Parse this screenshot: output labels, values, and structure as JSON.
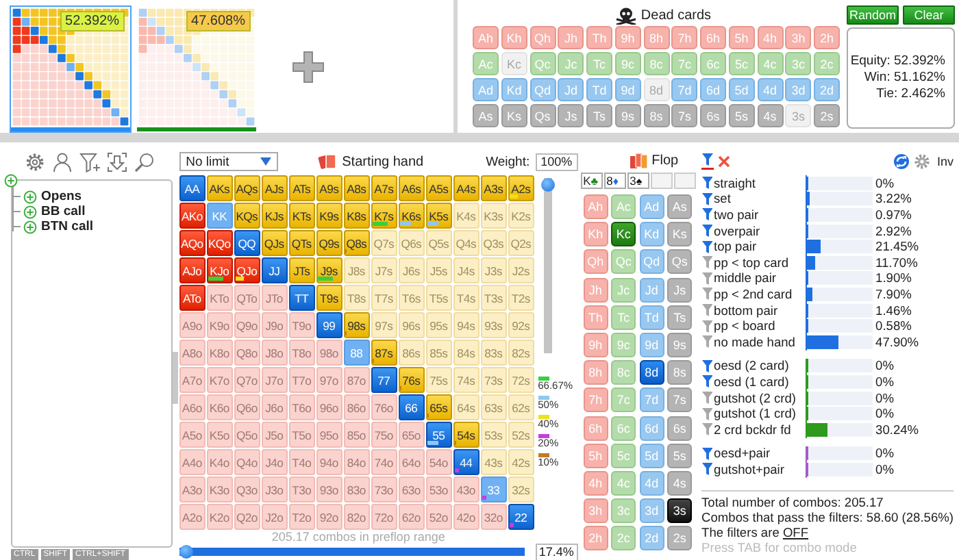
{
  "ranges": [
    {
      "selected": true,
      "badge": {
        "text": "52.392%",
        "color": "#d9f244"
      },
      "bar": {
        "color": "#2a8cf0"
      }
    },
    {
      "selected": false,
      "badge": {
        "text": "47.608%",
        "color": "#f6c94a"
      },
      "bar": {
        "color": "#16921a"
      }
    }
  ],
  "dead_cards": {
    "title": "Dead cards",
    "suits": [
      {
        "kind": "hearts",
        "cards": [
          {
            "label": "Ah",
            "disabled": false
          },
          {
            "label": "Kh",
            "disabled": false
          },
          {
            "label": "Qh",
            "disabled": false
          },
          {
            "label": "Jh",
            "disabled": false
          },
          {
            "label": "Th",
            "disabled": false
          },
          {
            "label": "9h",
            "disabled": false
          },
          {
            "label": "8h",
            "disabled": false
          },
          {
            "label": "7h",
            "disabled": false
          },
          {
            "label": "6h",
            "disabled": false
          },
          {
            "label": "5h",
            "disabled": false
          },
          {
            "label": "4h",
            "disabled": false
          },
          {
            "label": "3h",
            "disabled": false
          },
          {
            "label": "2h",
            "disabled": false
          }
        ]
      },
      {
        "kind": "clubs",
        "cards": [
          {
            "label": "Ac",
            "disabled": false
          },
          {
            "label": "Kc",
            "disabled": true
          },
          {
            "label": "Qc",
            "disabled": false
          },
          {
            "label": "Jc",
            "disabled": false
          },
          {
            "label": "Tc",
            "disabled": false
          },
          {
            "label": "9c",
            "disabled": false
          },
          {
            "label": "8c",
            "disabled": false
          },
          {
            "label": "7c",
            "disabled": false
          },
          {
            "label": "6c",
            "disabled": false
          },
          {
            "label": "5c",
            "disabled": false
          },
          {
            "label": "4c",
            "disabled": false
          },
          {
            "label": "3c",
            "disabled": false
          },
          {
            "label": "2c",
            "disabled": false
          }
        ]
      },
      {
        "kind": "diamonds",
        "cards": [
          {
            "label": "Ad",
            "disabled": false
          },
          {
            "label": "Kd",
            "disabled": false
          },
          {
            "label": "Qd",
            "disabled": false
          },
          {
            "label": "Jd",
            "disabled": false
          },
          {
            "label": "Td",
            "disabled": false
          },
          {
            "label": "9d",
            "disabled": false
          },
          {
            "label": "8d",
            "disabled": true
          },
          {
            "label": "7d",
            "disabled": false
          },
          {
            "label": "6d",
            "disabled": false
          },
          {
            "label": "5d",
            "disabled": false
          },
          {
            "label": "4d",
            "disabled": false
          },
          {
            "label": "3d",
            "disabled": false
          },
          {
            "label": "2d",
            "disabled": false
          }
        ]
      },
      {
        "kind": "spades",
        "cards": [
          {
            "label": "As",
            "disabled": false
          },
          {
            "label": "Ks",
            "disabled": false
          },
          {
            "label": "Qs",
            "disabled": false
          },
          {
            "label": "Js",
            "disabled": false
          },
          {
            "label": "Ts",
            "disabled": false
          },
          {
            "label": "9s",
            "disabled": false
          },
          {
            "label": "8s",
            "disabled": false
          },
          {
            "label": "7s",
            "disabled": false
          },
          {
            "label": "6s",
            "disabled": false
          },
          {
            "label": "5s",
            "disabled": false
          },
          {
            "label": "4s",
            "disabled": false
          },
          {
            "label": "3s",
            "disabled": true
          },
          {
            "label": "2s",
            "disabled": false
          }
        ]
      }
    ]
  },
  "buttons": [
    "Random",
    "Clear"
  ],
  "equity_lines": [
    "Equity: 52.392%",
    "Win: 51.162%",
    "Tie: 2.462%"
  ],
  "tree": {
    "children": [
      {
        "label": "Opens",
        "expanded": false
      },
      {
        "label": "BB call",
        "expanded": false
      },
      {
        "label": "BTN call",
        "expanded": false
      }
    ]
  },
  "modifier_keys": [
    "CTRL",
    "SHIFT",
    "CTRL+SHIFT"
  ],
  "hand_grid": {
    "game": "No limit",
    "title": "Starting hand",
    "weight_label": "Weight:",
    "weight": "100%",
    "weight_slider": {
      "level": 1
    },
    "rows": [
      {
        "cells": [
          {
            "label": "AA",
            "kind": "pair",
            "selected": true
          },
          {
            "label": "AKs",
            "kind": "suited",
            "selected": true
          },
          {
            "label": "AQs",
            "kind": "suited",
            "selected": true
          },
          {
            "label": "AJs",
            "kind": "suited",
            "selected": true
          },
          {
            "label": "ATs",
            "kind": "suited",
            "selected": true
          },
          {
            "label": "A9s",
            "kind": "suited",
            "selected": true
          },
          {
            "label": "A8s",
            "kind": "suited",
            "selected": true
          },
          {
            "label": "A7s",
            "kind": "suited",
            "selected": true
          },
          {
            "label": "A6s",
            "kind": "suited",
            "selected": true
          },
          {
            "label": "A5s",
            "kind": "suited",
            "selected": true
          },
          {
            "label": "A4s",
            "kind": "suited",
            "selected": true
          },
          {
            "label": "A3s",
            "kind": "suited",
            "selected": true
          },
          {
            "label": "A2s",
            "kind": "suited",
            "selected": true,
            "marker": {
              "color": "#ece21a",
              "level": 0.4
            }
          }
        ]
      },
      {
        "cells": [
          {
            "label": "AKo",
            "kind": "offsuit",
            "selected": true
          },
          {
            "label": "KK",
            "kind": "pair",
            "selected": true,
            "faded": true
          },
          {
            "label": "KQs",
            "kind": "suited",
            "selected": true
          },
          {
            "label": "KJs",
            "kind": "suited",
            "selected": true
          },
          {
            "label": "KTs",
            "kind": "suited",
            "selected": true
          },
          {
            "label": "K9s",
            "kind": "suited",
            "selected": true
          },
          {
            "label": "K8s",
            "kind": "suited",
            "selected": true
          },
          {
            "label": "K7s",
            "kind": "suited",
            "selected": true,
            "marker": {
              "color": "#3ccf3c",
              "level": 0.6667
            }
          },
          {
            "label": "K6s",
            "kind": "suited",
            "selected": true,
            "marker": {
              "color": "#8ec8f2",
              "level": 0.5
            }
          },
          {
            "label": "K5s",
            "kind": "suited",
            "selected": true,
            "marker": {
              "color": "#8ec8f2",
              "level": 0.5
            }
          },
          {
            "label": "K4s",
            "kind": "suited",
            "selected": false
          },
          {
            "label": "K3s",
            "kind": "suited",
            "selected": false
          },
          {
            "label": "K2s",
            "kind": "suited",
            "selected": false
          }
        ]
      },
      {
        "cells": [
          {
            "label": "AQo",
            "kind": "offsuit",
            "selected": true
          },
          {
            "label": "KQo",
            "kind": "offsuit",
            "selected": true
          },
          {
            "label": "QQ",
            "kind": "pair",
            "selected": true
          },
          {
            "label": "QJs",
            "kind": "suited",
            "selected": true
          },
          {
            "label": "QTs",
            "kind": "suited",
            "selected": true
          },
          {
            "label": "Q9s",
            "kind": "suited",
            "selected": true
          },
          {
            "label": "Q8s",
            "kind": "suited",
            "selected": true,
            "marker": {
              "color": "#c47a24",
              "level": 0.1
            }
          },
          {
            "label": "Q7s",
            "kind": "suited",
            "selected": false
          },
          {
            "label": "Q6s",
            "kind": "suited",
            "selected": false
          },
          {
            "label": "Q5s",
            "kind": "suited",
            "selected": false
          },
          {
            "label": "Q4s",
            "kind": "suited",
            "selected": false
          },
          {
            "label": "Q3s",
            "kind": "suited",
            "selected": false
          },
          {
            "label": "Q2s",
            "kind": "suited",
            "selected": false
          }
        ]
      },
      {
        "cells": [
          {
            "label": "AJo",
            "kind": "offsuit",
            "selected": true
          },
          {
            "label": "KJo",
            "kind": "offsuit",
            "selected": true,
            "marker": {
              "color": "#3ccf3c",
              "level": 0.6667
            }
          },
          {
            "label": "QJo",
            "kind": "offsuit",
            "selected": true,
            "marker": {
              "color": "#ece21a",
              "level": 0.4
            }
          },
          {
            "label": "JJ",
            "kind": "pair",
            "selected": true
          },
          {
            "label": "JTs",
            "kind": "suited",
            "selected": true
          },
          {
            "label": "J9s",
            "kind": "suited",
            "selected": true,
            "marker": {
              "color": "#3ccf3c",
              "level": 0.6667
            }
          },
          {
            "label": "J8s",
            "kind": "suited",
            "selected": false
          },
          {
            "label": "J7s",
            "kind": "suited",
            "selected": false
          },
          {
            "label": "J6s",
            "kind": "suited",
            "selected": false
          },
          {
            "label": "J5s",
            "kind": "suited",
            "selected": false
          },
          {
            "label": "J4s",
            "kind": "suited",
            "selected": false
          },
          {
            "label": "J3s",
            "kind": "suited",
            "selected": false
          },
          {
            "label": "J2s",
            "kind": "suited",
            "selected": false
          }
        ]
      },
      {
        "cells": [
          {
            "label": "ATo",
            "kind": "offsuit",
            "selected": true
          },
          {
            "label": "KTo",
            "kind": "offsuit",
            "selected": false
          },
          {
            "label": "QTo",
            "kind": "offsuit",
            "selected": false
          },
          {
            "label": "JTo",
            "kind": "offsuit",
            "selected": false
          },
          {
            "label": "TT",
            "kind": "pair",
            "selected": true
          },
          {
            "label": "T9s",
            "kind": "suited",
            "selected": true
          },
          {
            "label": "T8s",
            "kind": "suited",
            "selected": false
          },
          {
            "label": "T7s",
            "kind": "suited",
            "selected": false
          },
          {
            "label": "T6s",
            "kind": "suited",
            "selected": false
          },
          {
            "label": "T5s",
            "kind": "suited",
            "selected": false
          },
          {
            "label": "T4s",
            "kind": "suited",
            "selected": false
          },
          {
            "label": "T3s",
            "kind": "suited",
            "selected": false
          },
          {
            "label": "T2s",
            "kind": "suited",
            "selected": false
          }
        ]
      },
      {
        "cells": [
          {
            "label": "A9o",
            "kind": "offsuit",
            "selected": false
          },
          {
            "label": "K9o",
            "kind": "offsuit",
            "selected": false
          },
          {
            "label": "Q9o",
            "kind": "offsuit",
            "selected": false
          },
          {
            "label": "J9o",
            "kind": "offsuit",
            "selected": false
          },
          {
            "label": "T9o",
            "kind": "offsuit",
            "selected": false
          },
          {
            "label": "99",
            "kind": "pair",
            "selected": true
          },
          {
            "label": "98s",
            "kind": "suited",
            "selected": true,
            "marker": {
              "color": "#c47a24",
              "level": 0.1
            }
          },
          {
            "label": "97s",
            "kind": "suited",
            "selected": false
          },
          {
            "label": "96s",
            "kind": "suited",
            "selected": false
          },
          {
            "label": "95s",
            "kind": "suited",
            "selected": false
          },
          {
            "label": "94s",
            "kind": "suited",
            "selected": false
          },
          {
            "label": "93s",
            "kind": "suited",
            "selected": false
          },
          {
            "label": "92s",
            "kind": "suited",
            "selected": false
          }
        ]
      },
      {
        "cells": [
          {
            "label": "A8o",
            "kind": "offsuit",
            "selected": false
          },
          {
            "label": "K8o",
            "kind": "offsuit",
            "selected": false
          },
          {
            "label": "Q8o",
            "kind": "offsuit",
            "selected": false
          },
          {
            "label": "J8o",
            "kind": "offsuit",
            "selected": false
          },
          {
            "label": "T8o",
            "kind": "offsuit",
            "selected": false
          },
          {
            "label": "98o",
            "kind": "offsuit",
            "selected": false
          },
          {
            "label": "88",
            "kind": "pair",
            "selected": true,
            "faded": true
          },
          {
            "label": "87s",
            "kind": "suited",
            "selected": true,
            "marker": {
              "color": "#c47a24",
              "level": 0.1
            }
          },
          {
            "label": "86s",
            "kind": "suited",
            "selected": false
          },
          {
            "label": "85s",
            "kind": "suited",
            "selected": false
          },
          {
            "label": "84s",
            "kind": "suited",
            "selected": false
          },
          {
            "label": "83s",
            "kind": "suited",
            "selected": false
          },
          {
            "label": "82s",
            "kind": "suited",
            "selected": false
          }
        ]
      },
      {
        "cells": [
          {
            "label": "A7o",
            "kind": "offsuit",
            "selected": false
          },
          {
            "label": "K7o",
            "kind": "offsuit",
            "selected": false
          },
          {
            "label": "Q7o",
            "kind": "offsuit",
            "selected": false
          },
          {
            "label": "J7o",
            "kind": "offsuit",
            "selected": false
          },
          {
            "label": "T7o",
            "kind": "offsuit",
            "selected": false
          },
          {
            "label": "97o",
            "kind": "offsuit",
            "selected": false
          },
          {
            "label": "87o",
            "kind": "offsuit",
            "selected": false
          },
          {
            "label": "77",
            "kind": "pair",
            "selected": true
          },
          {
            "label": "76s",
            "kind": "suited",
            "selected": true,
            "marker": {
              "color": "#c47a24",
              "level": 0.1
            }
          },
          {
            "label": "75s",
            "kind": "suited",
            "selected": false
          },
          {
            "label": "74s",
            "kind": "suited",
            "selected": false
          },
          {
            "label": "73s",
            "kind": "suited",
            "selected": false
          },
          {
            "label": "72s",
            "kind": "suited",
            "selected": false
          }
        ]
      },
      {
        "cells": [
          {
            "label": "A6o",
            "kind": "offsuit",
            "selected": false
          },
          {
            "label": "K6o",
            "kind": "offsuit",
            "selected": false
          },
          {
            "label": "Q6o",
            "kind": "offsuit",
            "selected": false
          },
          {
            "label": "J6o",
            "kind": "offsuit",
            "selected": false
          },
          {
            "label": "T6o",
            "kind": "offsuit",
            "selected": false
          },
          {
            "label": "96o",
            "kind": "offsuit",
            "selected": false
          },
          {
            "label": "86o",
            "kind": "offsuit",
            "selected": false
          },
          {
            "label": "76o",
            "kind": "offsuit",
            "selected": false
          },
          {
            "label": "66",
            "kind": "pair",
            "selected": true
          },
          {
            "label": "65s",
            "kind": "suited",
            "selected": true,
            "marker": {
              "color": "#c47a24",
              "level": 0.1
            }
          },
          {
            "label": "64s",
            "kind": "suited",
            "selected": false
          },
          {
            "label": "63s",
            "kind": "suited",
            "selected": false
          },
          {
            "label": "62s",
            "kind": "suited",
            "selected": false
          }
        ]
      },
      {
        "cells": [
          {
            "label": "A5o",
            "kind": "offsuit",
            "selected": false
          },
          {
            "label": "K5o",
            "kind": "offsuit",
            "selected": false
          },
          {
            "label": "Q5o",
            "kind": "offsuit",
            "selected": false
          },
          {
            "label": "J5o",
            "kind": "offsuit",
            "selected": false
          },
          {
            "label": "T5o",
            "kind": "offsuit",
            "selected": false
          },
          {
            "label": "95o",
            "kind": "offsuit",
            "selected": false
          },
          {
            "label": "85o",
            "kind": "offsuit",
            "selected": false
          },
          {
            "label": "75o",
            "kind": "offsuit",
            "selected": false
          },
          {
            "label": "65o",
            "kind": "offsuit",
            "selected": false
          },
          {
            "label": "55",
            "kind": "pair",
            "selected": true,
            "marker": {
              "color": "#8ec8f2",
              "level": 0.5
            }
          },
          {
            "label": "54s",
            "kind": "suited",
            "selected": true,
            "marker": {
              "color": "#c47a24",
              "level": 0.1
            }
          },
          {
            "label": "53s",
            "kind": "suited",
            "selected": false
          },
          {
            "label": "52s",
            "kind": "suited",
            "selected": false
          }
        ]
      },
      {
        "cells": [
          {
            "label": "A4o",
            "kind": "offsuit",
            "selected": false
          },
          {
            "label": "K4o",
            "kind": "offsuit",
            "selected": false
          },
          {
            "label": "Q4o",
            "kind": "offsuit",
            "selected": false
          },
          {
            "label": "J4o",
            "kind": "offsuit",
            "selected": false
          },
          {
            "label": "T4o",
            "kind": "offsuit",
            "selected": false
          },
          {
            "label": "94o",
            "kind": "offsuit",
            "selected": false
          },
          {
            "label": "84o",
            "kind": "offsuit",
            "selected": false
          },
          {
            "label": "74o",
            "kind": "offsuit",
            "selected": false
          },
          {
            "label": "64o",
            "kind": "offsuit",
            "selected": false
          },
          {
            "label": "54o",
            "kind": "offsuit",
            "selected": false
          },
          {
            "label": "44",
            "kind": "pair",
            "selected": true,
            "marker": {
              "color": "#c43ee0",
              "level": 0.2
            }
          },
          {
            "label": "43s",
            "kind": "suited",
            "selected": false
          },
          {
            "label": "42s",
            "kind": "suited",
            "selected": false
          }
        ]
      },
      {
        "cells": [
          {
            "label": "A3o",
            "kind": "offsuit",
            "selected": false
          },
          {
            "label": "K3o",
            "kind": "offsuit",
            "selected": false
          },
          {
            "label": "Q3o",
            "kind": "offsuit",
            "selected": false
          },
          {
            "label": "J3o",
            "kind": "offsuit",
            "selected": false
          },
          {
            "label": "T3o",
            "kind": "offsuit",
            "selected": false
          },
          {
            "label": "93o",
            "kind": "offsuit",
            "selected": false
          },
          {
            "label": "83o",
            "kind": "offsuit",
            "selected": false
          },
          {
            "label": "73o",
            "kind": "offsuit",
            "selected": false
          },
          {
            "label": "63o",
            "kind": "offsuit",
            "selected": false
          },
          {
            "label": "53o",
            "kind": "offsuit",
            "selected": false
          },
          {
            "label": "43o",
            "kind": "offsuit",
            "selected": false
          },
          {
            "label": "33",
            "kind": "pair",
            "selected": true,
            "faded": true,
            "marker": {
              "color": "#c43ee0",
              "level": 0.2
            }
          },
          {
            "label": "32s",
            "kind": "suited",
            "selected": false
          }
        ]
      },
      {
        "cells": [
          {
            "label": "A2o",
            "kind": "offsuit",
            "selected": false
          },
          {
            "label": "K2o",
            "kind": "offsuit",
            "selected": false
          },
          {
            "label": "Q2o",
            "kind": "offsuit",
            "selected": false
          },
          {
            "label": "J2o",
            "kind": "offsuit",
            "selected": false
          },
          {
            "label": "T2o",
            "kind": "offsuit",
            "selected": false
          },
          {
            "label": "92o",
            "kind": "offsuit",
            "selected": false
          },
          {
            "label": "82o",
            "kind": "offsuit",
            "selected": false
          },
          {
            "label": "72o",
            "kind": "offsuit",
            "selected": false
          },
          {
            "label": "62o",
            "kind": "offsuit",
            "selected": false
          },
          {
            "label": "52o",
            "kind": "offsuit",
            "selected": false
          },
          {
            "label": "42o",
            "kind": "offsuit",
            "selected": false
          },
          {
            "label": "32o",
            "kind": "offsuit",
            "selected": false
          },
          {
            "label": "22",
            "kind": "pair",
            "selected": true,
            "marker": {
              "color": "#c43ee0",
              "level": 0.2
            }
          }
        ]
      }
    ],
    "legend": [
      {
        "label": "66.67%",
        "color": "#3ccf3c"
      },
      {
        "label": "50%",
        "color": "#8ec8f2"
      },
      {
        "label": "40%",
        "color": "#ece21a"
      },
      {
        "label": "20%",
        "color": "#c43ee0"
      },
      {
        "label": "10%",
        "color": "#c47a24"
      }
    ],
    "combos_text": "205.17 combos in preflop range",
    "range_slider": {
      "level": 0
    },
    "range_percent": "17.4%"
  },
  "flop": {
    "title": "Flop",
    "board": [
      {
        "kind": "clubs",
        "rank": "K",
        "symbol": "♣"
      },
      {
        "kind": "diamonds",
        "rank": "8",
        "symbol": "♦"
      },
      {
        "kind": "spades",
        "rank": "3",
        "symbol": "♠"
      },
      {
        "kind": "empty"
      },
      {
        "kind": "empty"
      }
    ],
    "deck": [
      {
        "kind": "hearts",
        "cards": [
          {
            "label": "Ah",
            "selected": false
          },
          {
            "label": "Kh",
            "selected": false
          },
          {
            "label": "Qh",
            "selected": false
          },
          {
            "label": "Jh",
            "selected": false
          },
          {
            "label": "Th",
            "selected": false
          },
          {
            "label": "9h",
            "selected": false
          },
          {
            "label": "8h",
            "selected": false
          },
          {
            "label": "7h",
            "selected": false
          },
          {
            "label": "6h",
            "selected": false
          },
          {
            "label": "5h",
            "selected": false
          },
          {
            "label": "4h",
            "selected": false
          },
          {
            "label": "3h",
            "selected": false
          },
          {
            "label": "2h",
            "selected": false
          }
        ]
      },
      {
        "kind": "clubs",
        "cards": [
          {
            "label": "Ac",
            "selected": false
          },
          {
            "label": "Kc",
            "selected": true
          },
          {
            "label": "Qc",
            "selected": false
          },
          {
            "label": "Jc",
            "selected": false
          },
          {
            "label": "Tc",
            "selected": false
          },
          {
            "label": "9c",
            "selected": false
          },
          {
            "label": "8c",
            "selected": false
          },
          {
            "label": "7c",
            "selected": false
          },
          {
            "label": "6c",
            "selected": false
          },
          {
            "label": "5c",
            "selected": false
          },
          {
            "label": "4c",
            "selected": false
          },
          {
            "label": "3c",
            "selected": false
          },
          {
            "label": "2c",
            "selected": false
          }
        ]
      },
      {
        "kind": "diamonds",
        "cards": [
          {
            "label": "Ad",
            "selected": false
          },
          {
            "label": "Kd",
            "selected": false
          },
          {
            "label": "Qd",
            "selected": false
          },
          {
            "label": "Jd",
            "selected": false
          },
          {
            "label": "Td",
            "selected": false
          },
          {
            "label": "9d",
            "selected": false
          },
          {
            "label": "8d",
            "selected": true
          },
          {
            "label": "7d",
            "selected": false
          },
          {
            "label": "6d",
            "selected": false
          },
          {
            "label": "5d",
            "selected": false
          },
          {
            "label": "4d",
            "selected": false
          },
          {
            "label": "3d",
            "selected": false
          },
          {
            "label": "2d",
            "selected": false
          }
        ]
      },
      {
        "kind": "spades",
        "cards": [
          {
            "label": "As",
            "selected": false
          },
          {
            "label": "Ks",
            "selected": false
          },
          {
            "label": "Qs",
            "selected": false
          },
          {
            "label": "Js",
            "selected": false
          },
          {
            "label": "Ts",
            "selected": false
          },
          {
            "label": "9s",
            "selected": false
          },
          {
            "label": "8s",
            "selected": false
          },
          {
            "label": "7s",
            "selected": false
          },
          {
            "label": "6s",
            "selected": false
          },
          {
            "label": "5s",
            "selected": false
          },
          {
            "label": "4s",
            "selected": false
          },
          {
            "label": "3s",
            "selected": true
          },
          {
            "label": "2s",
            "selected": false
          }
        ]
      }
    ]
  },
  "filters": {
    "inverse_label": "Inv",
    "groups": [
      {
        "color": "#1f6fe0",
        "rows": [
          {
            "label": "straight",
            "active": true,
            "level": 0,
            "value": "0%"
          },
          {
            "label": "set",
            "active": true,
            "level": 0.0322,
            "value": "3.22%"
          },
          {
            "label": "two pair",
            "active": true,
            "level": 0.0097,
            "value": "0.97%"
          },
          {
            "label": "overpair",
            "active": true,
            "level": 0.0292,
            "value": "2.92%"
          },
          {
            "label": "top pair",
            "active": true,
            "level": 0.2145,
            "value": "21.45%"
          },
          {
            "label": "pp < top card",
            "active": false,
            "level": 0.117,
            "value": "11.70%"
          },
          {
            "label": "middle pair",
            "active": false,
            "level": 0.019,
            "value": "1.90%"
          },
          {
            "label": "pp < 2nd card",
            "active": false,
            "level": 0.079,
            "value": "7.90%"
          },
          {
            "label": "bottom pair",
            "active": false,
            "level": 0.0146,
            "value": "1.46%"
          },
          {
            "label": "pp < board",
            "active": false,
            "level": 0.0058,
            "value": "0.58%"
          },
          {
            "label": "no made hand",
            "active": false,
            "level": 0.479,
            "value": "47.90%"
          }
        ]
      },
      {
        "color": "#2e9a1e",
        "rows": [
          {
            "label": "oesd (2 card)",
            "active": true,
            "level": 0,
            "value": "0%"
          },
          {
            "label": "oesd (1 card)",
            "active": true,
            "level": 0,
            "value": "0%"
          },
          {
            "label": "gutshot (2 crd)",
            "active": false,
            "level": 0,
            "value": "0%"
          },
          {
            "label": "gutshot (1 crd)",
            "active": false,
            "level": 0,
            "value": "0%"
          },
          {
            "label": "2 crd bckdr fd",
            "active": false,
            "level": 0.3024,
            "value": "30.24%"
          }
        ]
      },
      {
        "color": "#a45cc8",
        "rows": [
          {
            "label": "oesd+pair",
            "active": true,
            "level": 0,
            "value": "0%"
          },
          {
            "label": "gutshot+pair",
            "active": true,
            "level": 0,
            "value": "0%"
          }
        ]
      }
    ],
    "summary": [
      "Total number of combos: 205.17",
      "Combos that pass the filters: 58.60 (28.56%)"
    ],
    "status": {
      "text": "The filters are ",
      "link": "OFF"
    },
    "hint": "Press TAB for combo mode"
  }
}
